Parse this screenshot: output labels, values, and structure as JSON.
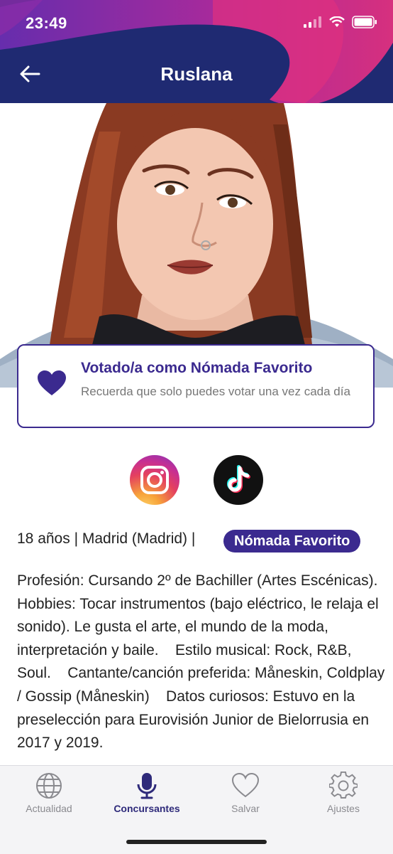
{
  "status": {
    "time": "23:49"
  },
  "header": {
    "title": "Ruslana"
  },
  "vote": {
    "title": "Votado/a como Nómada Favorito",
    "subtitle": "Recuerda que solo puedes votar una vez cada día"
  },
  "profile": {
    "info": "18 años | Madrid (Madrid) |",
    "badge": "Nómada Favorito",
    "bio": "Profesión: Cursando 2º de Bachiller (Artes Escénicas).  Hobbies: Tocar instrumentos (bajo eléctrico, le relaja el sonido). Le gusta el arte, el mundo de la moda, interpretación y baile.    Estilo musical: Rock, R&B, Soul.    Cantante/canción preferida: Måneskin, Coldplay / Gossip (Måneskin)    Datos curiosos: Estuvo en la preselección para Eurovisión Junior de Bielorrusia en 2017 y 2019."
  },
  "tabs": [
    {
      "label": "Actualidad",
      "icon": "globe-icon",
      "active": false
    },
    {
      "label": "Concursantes",
      "icon": "microphone-icon",
      "active": true
    },
    {
      "label": "Salvar",
      "icon": "heart-icon",
      "active": false
    },
    {
      "label": "Ajustes",
      "icon": "gear-icon",
      "active": false
    }
  ],
  "colors": {
    "accent": "#3b2a8f",
    "header_bg": "#1f2a72",
    "swoosh": "#d0308e"
  }
}
